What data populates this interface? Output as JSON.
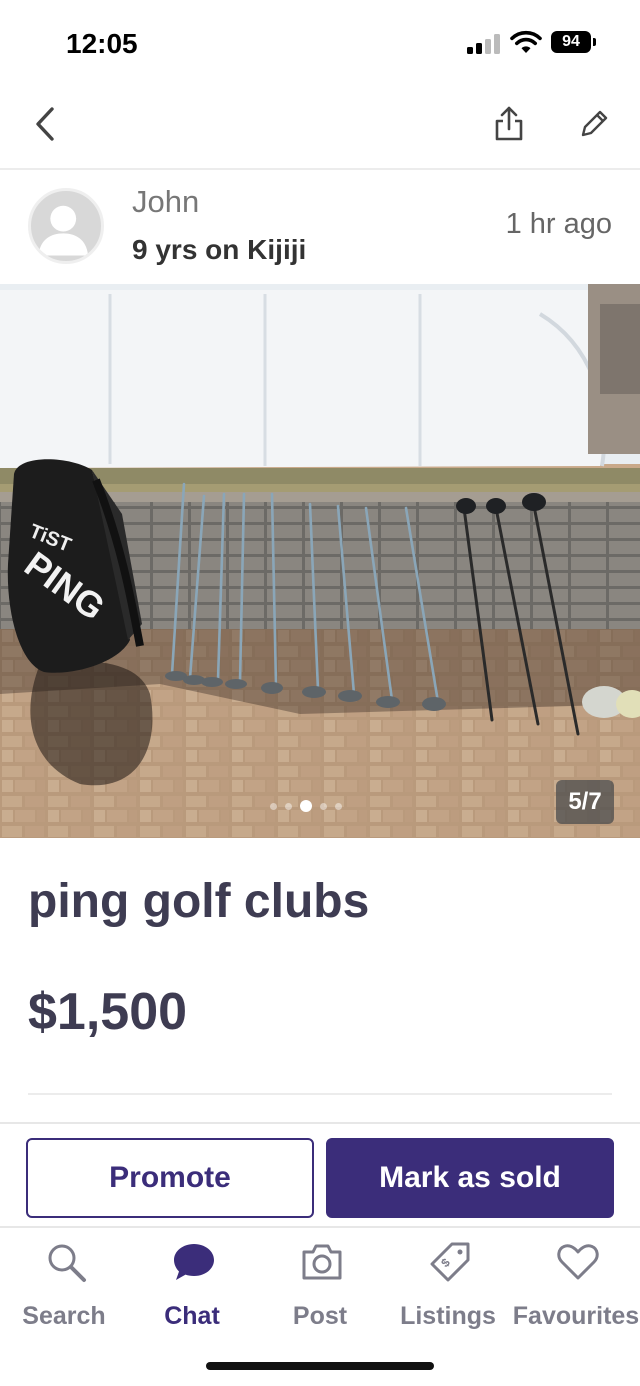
{
  "status_bar": {
    "time": "12:05",
    "battery": "94"
  },
  "seller": {
    "name": "John",
    "tenure": "9 yrs on Kijiji",
    "posted": "1 hr ago"
  },
  "gallery": {
    "counter": "5/7",
    "photo_text": {
      "bag_brand": "PING",
      "bag_model": "TiST"
    }
  },
  "listing": {
    "title": "ping golf clubs",
    "price": "$1,500"
  },
  "actions": {
    "promote_label": "Promote",
    "mark_sold_label": "Mark as sold"
  },
  "nav": [
    {
      "label": "Search",
      "icon": "search-icon"
    },
    {
      "label": "Chat",
      "icon": "chat-icon"
    },
    {
      "label": "Post",
      "icon": "camera-icon"
    },
    {
      "label": "Listings",
      "icon": "price-tag-icon"
    },
    {
      "label": "Favourites",
      "icon": "heart-icon"
    }
  ],
  "colors": {
    "brand": "#3b2d7a",
    "text": "#3e3c52",
    "muted": "#7d7d8a"
  }
}
